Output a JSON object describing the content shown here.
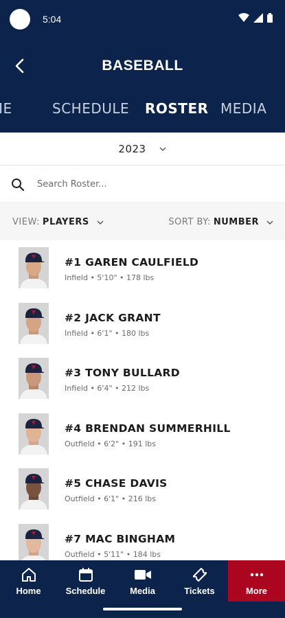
{
  "status": {
    "time": "5:04"
  },
  "header": {
    "title": "BASEBALL",
    "tabs": [
      {
        "label": "HOME",
        "active": false
      },
      {
        "label": "SCHEDULE",
        "active": false
      },
      {
        "label": "ROSTER",
        "active": true
      },
      {
        "label": "MEDIA",
        "active": false
      }
    ]
  },
  "season": {
    "year": "2023"
  },
  "search": {
    "placeholder": "Search Roster..."
  },
  "filters": {
    "view_key": "VIEW:",
    "view_value": "PLAYERS",
    "sort_key": "SORT BY:",
    "sort_value": "NUMBER"
  },
  "players": [
    {
      "name": "#1 GAREN CAULFIELD",
      "meta": "Infield • 5'10\" • 178 lbs"
    },
    {
      "name": "#2 JACK GRANT",
      "meta": "Infield • 6'1\" • 180 lbs"
    },
    {
      "name": "#3 TONY BULLARD",
      "meta": "Infield • 6'4\" • 212 lbs"
    },
    {
      "name": "#4 BRENDAN SUMMERHILL",
      "meta": "Outfield • 6'2\" • 191 lbs"
    },
    {
      "name": "#5 CHASE DAVIS",
      "meta": "Outfield • 6'1\" • 216 lbs"
    },
    {
      "name": "#7 MAC BINGHAM",
      "meta": "Outfield • 5'11\" • 184 lbs"
    }
  ],
  "bottom_nav": [
    {
      "label": "Home",
      "icon": "home-icon"
    },
    {
      "label": "Schedule",
      "icon": "calendar-icon"
    },
    {
      "label": "Media",
      "icon": "video-camera-icon"
    },
    {
      "label": "Tickets",
      "icon": "ticket-icon"
    },
    {
      "label": "More",
      "icon": "more-dots-icon"
    }
  ],
  "colors": {
    "navy": "#0c234b",
    "red": "#ab0520"
  }
}
